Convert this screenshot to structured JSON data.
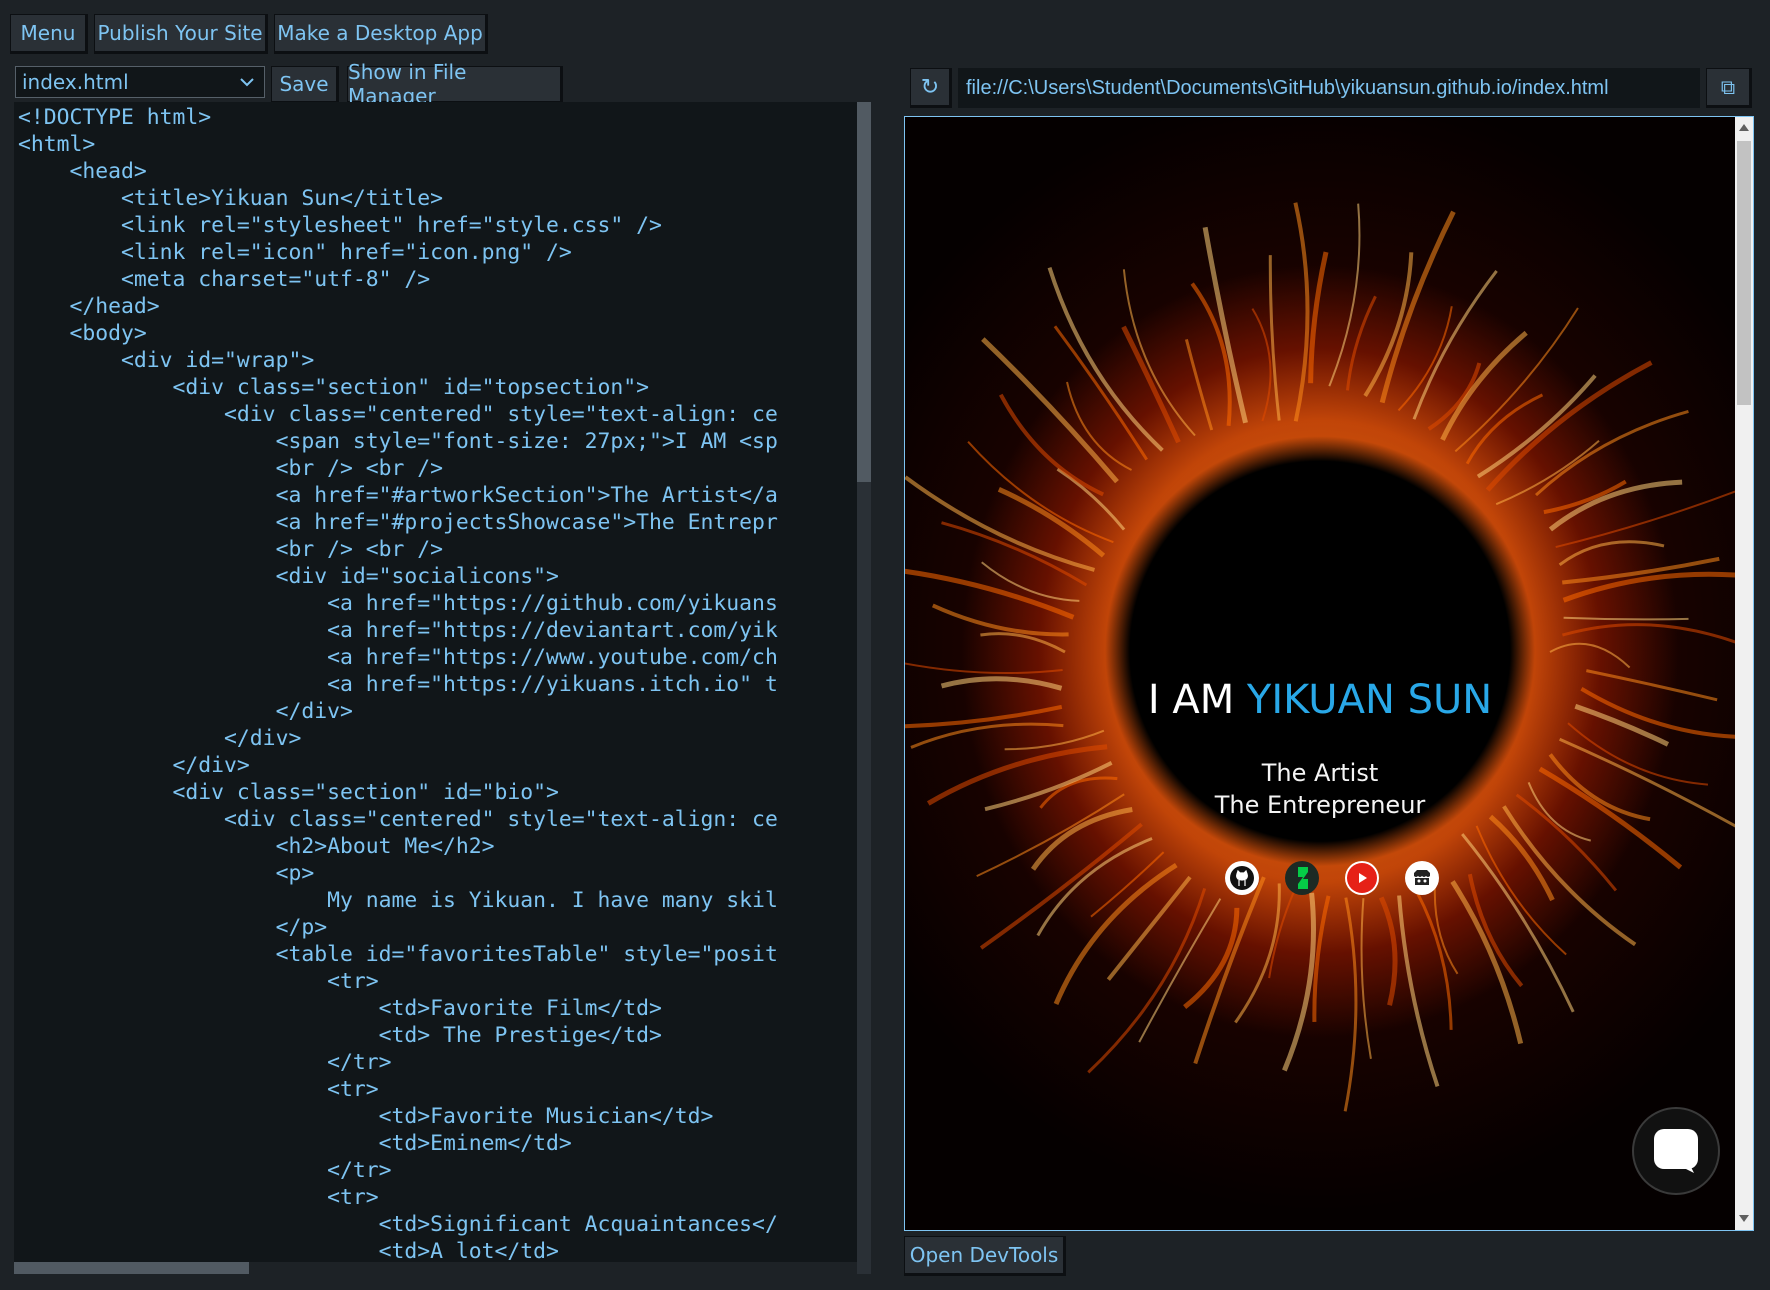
{
  "toolbar": {
    "menu": "Menu",
    "publish": "Publish Your Site",
    "desktop_app": "Make a Desktop App"
  },
  "editor_bar": {
    "file": "index.html",
    "save": "Save",
    "show_in_file_manager": "Show in File Manager"
  },
  "code_lines": [
    "<!DOCTYPE html>",
    "<html>",
    "    <head>",
    "        <title>Yikuan Sun</title>",
    "        <link rel=\"stylesheet\" href=\"style.css\" />",
    "        <link rel=\"icon\" href=\"icon.png\" />",
    "        <meta charset=\"utf-8\" />",
    "    </head>",
    "    <body>",
    "        <div id=\"wrap\">",
    "            <div class=\"section\" id=\"topsection\">",
    "                <div class=\"centered\" style=\"text-align: ce",
    "                    <span style=\"font-size: 27px;\">I AM <sp",
    "                    <br /> <br />",
    "                    <a href=\"#artworkSection\">The Artist</a",
    "                    <a href=\"#projectsShowcase\">The Entrepr",
    "                    <br /> <br />",
    "                    <div id=\"socialicons\">",
    "                        <a href=\"https://github.com/yikuans",
    "                        <a href=\"https://deviantart.com/yik",
    "                        <a href=\"https://www.youtube.com/ch",
    "                        <a href=\"https://yikuans.itch.io\" t",
    "                    </div>",
    "                </div>",
    "            </div>",
    "            <div class=\"section\" id=\"bio\">",
    "                <div class=\"centered\" style=\"text-align: ce",
    "                    <h2>About Me</h2>",
    "                    <p>",
    "                        My name is Yikuan. I have many skil",
    "                    </p>",
    "                    <table id=\"favoritesTable\" style=\"posit",
    "                        <tr>",
    "                            <td>Favorite Film</td>",
    "                            <td> The Prestige</td>",
    "                        </tr>",
    "                        <tr>",
    "                            <td>Favorite Musician</td>",
    "                            <td>Eminem</td>",
    "                        </tr>",
    "                        <tr>",
    "                            <td>Significant Acquaintances</",
    "                            <td>A lot</td>"
  ],
  "browser": {
    "refresh_icon": "↻",
    "url": "file://C:\\Users\\Student\\Documents\\GitHub\\yikuansun.github.io/index.html",
    "popout_icon": "⧉",
    "devtools": "Open DevTools"
  },
  "site": {
    "title_prefix": "I AM ",
    "title_name": "YIKUAN SUN",
    "link_artist": "The Artist",
    "link_entrepreneur": "The Entrepreneur",
    "socials": [
      "github-icon",
      "deviantart-icon",
      "youtube-icon",
      "itchio-icon"
    ],
    "accent": "#29a8e8"
  },
  "colors": {
    "ui_text": "#7ec4f2",
    "ui_bg": "#1d2226",
    "editor_bg": "#111619"
  }
}
